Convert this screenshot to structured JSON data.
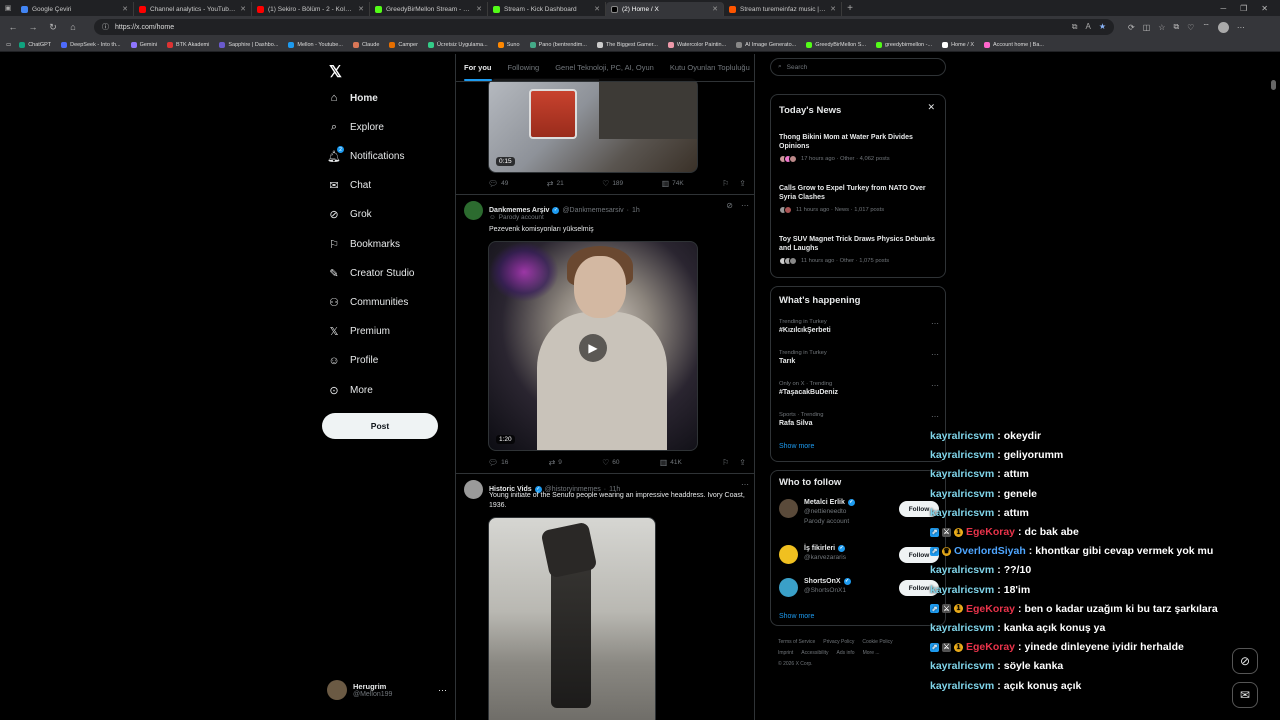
{
  "browser": {
    "tabs": [
      {
        "title": "Google Çeviri",
        "color": "#4285f4",
        "active": false
      },
      {
        "title": "Channel analytics - YouTube Studio",
        "color": "#ff0000",
        "active": false
      },
      {
        "title": "(1) Sekiro - Bölüm - 2 - Kolay Boss",
        "color": "#ff0000",
        "active": false
      },
      {
        "title": "GreedyBirMellon Stream - Watch Li",
        "color": "#53fc18",
        "active": false
      },
      {
        "title": "Stream - Kick Dashboard",
        "color": "#53fc18",
        "active": false
      },
      {
        "title": "(2) Home / X",
        "color": "#000000",
        "active": true
      },
      {
        "title": "Stream turemeinfaz music | Listen",
        "color": "#ff5500",
        "active": false
      }
    ],
    "url": "https://x.com/home",
    "bookmarks": [
      "ChatGPT",
      "DeepSeek - Into th...",
      "Gemini",
      "BTK Akademi",
      "Sapphire | Dashbo...",
      "Mellon - Youtube...",
      "Claude",
      "Camper",
      "Ücretsiz Uygulama...",
      "Suno",
      "Pano (bentrendim...",
      "The Biggest Gamer...",
      "Watercolor Paintin...",
      "AI Image Generato...",
      "GreedyBirMellon S...",
      "greedybirmellon -...",
      "Home / X",
      "Account home | Ba..."
    ]
  },
  "leftnav": {
    "items": [
      {
        "label": "Home",
        "icon": "home-icon"
      },
      {
        "label": "Explore",
        "icon": "search-icon"
      },
      {
        "label": "Notifications",
        "icon": "bell-icon",
        "badge": "2"
      },
      {
        "label": "Chat",
        "icon": "mail-icon"
      },
      {
        "label": "Grok",
        "icon": "grok-icon"
      },
      {
        "label": "Bookmarks",
        "icon": "bookmark-icon"
      },
      {
        "label": "Creator Studio",
        "icon": "creator-icon"
      },
      {
        "label": "Communities",
        "icon": "people-icon"
      },
      {
        "label": "Premium",
        "icon": "x-icon"
      },
      {
        "label": "Profile",
        "icon": "person-icon"
      },
      {
        "label": "More",
        "icon": "more-icon"
      }
    ],
    "post_label": "Post",
    "account": {
      "name": "Herugrim",
      "handle": "@Mellon199"
    }
  },
  "timeline": {
    "tabs": [
      "For you",
      "Following",
      "Genel Teknoloji, PC, AI, Oyun",
      "Kutu Oyunları Topluluğu"
    ],
    "tweet0": {
      "duration": "0:15",
      "replies": "49",
      "reposts": "21",
      "likes": "189",
      "views": "74K"
    },
    "tweet1": {
      "name": "Dankmemes Arşiv",
      "handle": "@Dankmemesarsiv",
      "time": "1h",
      "parody": "Parody account",
      "text": "Pezevenk komisyonları yükselmiş",
      "duration": "1:20",
      "replies": "16",
      "reposts": "9",
      "likes": "60",
      "views": "41K"
    },
    "tweet2": {
      "name": "Historic Vids",
      "handle": "@historyinmemes",
      "time": "11h",
      "text": "Young initiate of the Senufo people wearing an impressive headdress. Ivory Coast, 1936."
    }
  },
  "sidebar": {
    "search_placeholder": "Search",
    "news_title": "Today's News",
    "news": [
      {
        "title": "Thong Bikini Mom at Water Park Divides Opinions",
        "meta": "17 hours ago · Other · 4,062 posts"
      },
      {
        "title": "Calls Grow to Expel Turkey from NATO Over Syria Clashes",
        "meta": "11 hours ago · News · 1,017 posts"
      },
      {
        "title": "Toy SUV Magnet Trick Draws Physics Debunks and Laughs",
        "meta": "11 hours ago · Other · 1,075 posts"
      }
    ],
    "happening_title": "What's happening",
    "trends": [
      {
        "context": "Trending in Turkey",
        "name": "#KızılcıkŞerbeti"
      },
      {
        "context": "Trending in Turkey",
        "name": "Tarık"
      },
      {
        "context": "Only on X · Trending",
        "name": "#TaşacakBuDeniz"
      },
      {
        "context": "Sports · Trending",
        "name": "Rafa Silva"
      }
    ],
    "show_more": "Show more",
    "wtf_title": "Who to follow",
    "wtf": [
      {
        "name": "Metalci Erlik",
        "handle": "@nettieneedto",
        "sub": "Parody account"
      },
      {
        "name": "İş fikirleri",
        "handle": "@karvezararis",
        "sub": ""
      },
      {
        "name": "ShortsOnX",
        "handle": "@ShortsOnX1",
        "sub": ""
      }
    ],
    "follow_label": "Follow",
    "footer": [
      "Terms of Service",
      "Privacy Policy",
      "Cookie Policy",
      "Imprint",
      "Accessibility",
      "Ads info",
      "More ...",
      "© 2026 X Corp."
    ]
  },
  "chat": [
    {
      "user": "kayralricsvm",
      "msg": "okeydir",
      "style": "cyan"
    },
    {
      "user": "kayralricsvm",
      "msg": "geliyorumm",
      "style": "cyan"
    },
    {
      "user": "kayralricsvm",
      "msg": "attım",
      "style": "cyan"
    },
    {
      "user": "kayralricsvm",
      "msg": "genele",
      "style": "cyan"
    },
    {
      "user": "kayralricsvm",
      "msg": "attım",
      "style": "cyan"
    },
    {
      "user": "EgeKoray",
      "msg": "dc bak abe",
      "style": "red"
    },
    {
      "user": "OverlordSiyah",
      "msg": "khontkar gibi cevap vermek yok mu",
      "style": "blue"
    },
    {
      "user": "kayralricsvm",
      "msg": "??/10",
      "style": "cyan"
    },
    {
      "user": "kayralricsvm",
      "msg": "18'im",
      "style": "cyan"
    },
    {
      "user": "EgeKoray",
      "msg": "ben o kadar uzağım ki bu tarz şarkılara",
      "style": "red"
    },
    {
      "user": "kayralricsvm",
      "msg": "kanka açık konuş ya",
      "style": "cyan"
    },
    {
      "user": "EgeKoray",
      "msg": "yinede dinleyene iyidir herhalde",
      "style": "red"
    },
    {
      "user": "kayralricsvm",
      "msg": "söyle kanka",
      "style": "cyan"
    },
    {
      "user": "kayralricsvm",
      "msg": "açık konuş açık",
      "style": "cyan"
    }
  ]
}
